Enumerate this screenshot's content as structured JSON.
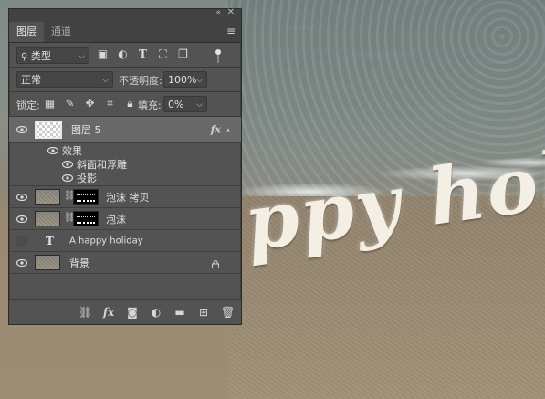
{
  "panel": {
    "tabs": [
      {
        "label": "图层",
        "active": true
      },
      {
        "label": "通道",
        "active": false
      }
    ],
    "filter": {
      "label": "类型",
      "icon": "search-icon"
    },
    "blend_mode": "正常",
    "opacity_label": "不透明度:",
    "opacity_value": "100%",
    "lock_label": "锁定:",
    "fill_label": "填充:",
    "fill_value": "0%"
  },
  "layers": [
    {
      "name": "图层 5",
      "visible": true,
      "selected": true,
      "thumb": "transparent",
      "fx": "fx",
      "effects_label": "效果",
      "effects": [
        "斜面和浮雕",
        "投影"
      ]
    },
    {
      "name": "泡沫 拷贝",
      "visible": true,
      "thumb": "sand",
      "mask": true
    },
    {
      "name": "泡沫",
      "visible": true,
      "thumb": "sand",
      "mask": true
    },
    {
      "name": "A happy holiday",
      "visible": false,
      "type": "T"
    },
    {
      "name": "背景",
      "visible": true,
      "thumb": "sand",
      "locked": true
    }
  ],
  "canvas": {
    "text": "ppy holic"
  },
  "colors": {
    "panel_bg": "#535353",
    "panel_header": "#424242",
    "selected_row": "#686868",
    "text": "#e2e2e2"
  }
}
